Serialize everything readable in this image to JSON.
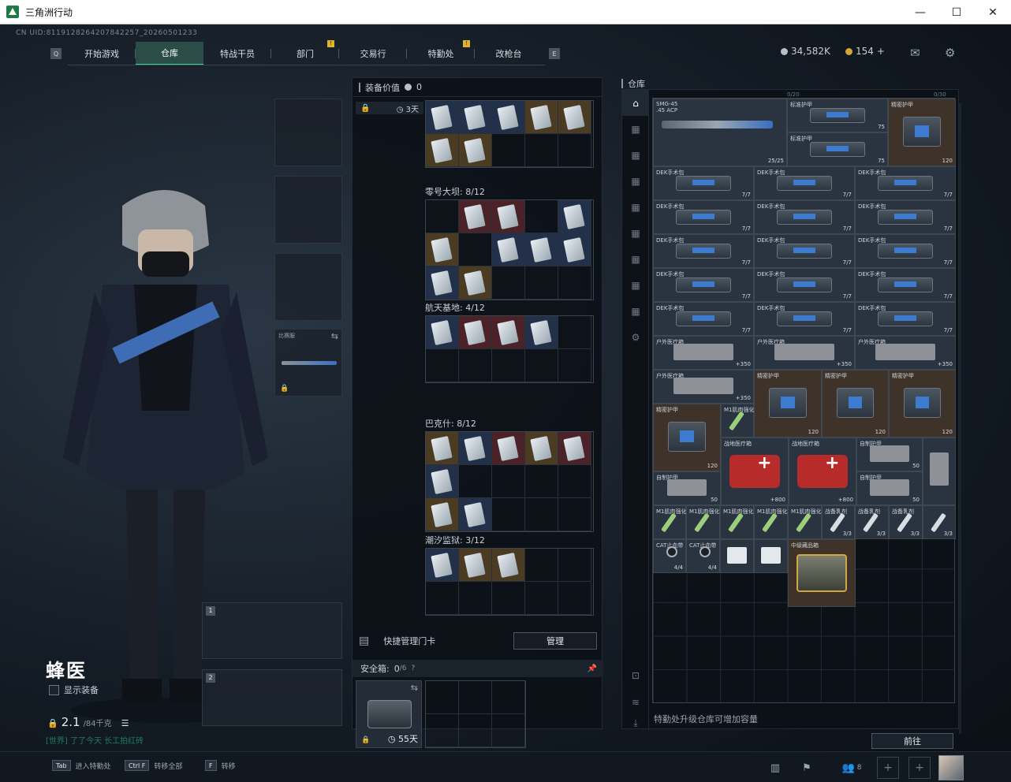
{
  "window": {
    "title": "三角洲行动",
    "controls": [
      "—",
      "☐",
      "✕"
    ]
  },
  "uid": "CN UID:8119128264207842257_20260501233",
  "nav": {
    "tabs": [
      {
        "label": "开始游戏",
        "active": false,
        "alert": false
      },
      {
        "label": "仓库",
        "active": true,
        "alert": false
      },
      {
        "label": "特战干员",
        "active": false,
        "alert": false
      },
      {
        "label": "部门",
        "active": false,
        "alert": true
      },
      {
        "label": "交易行",
        "active": false,
        "alert": false
      },
      {
        "label": "特勤处",
        "active": false,
        "alert": true
      },
      {
        "label": "改枪台",
        "active": false,
        "alert": false
      }
    ],
    "left_key": "Q",
    "right_key": "E",
    "alert_mark": "!"
  },
  "currency": {
    "hafcoin": "34,582K",
    "tickets": "154",
    "plus": "+"
  },
  "character": {
    "name": "蜂医",
    "show_equipment": "显示装备",
    "weight": "2.1",
    "weight_max": "/84千克",
    "tags": "[世界] 了了今天 长工拍红砖"
  },
  "slots": {
    "secure_weapon_label": "比赛服",
    "weapon_1": "1",
    "weapon_2": "2"
  },
  "keychain": {
    "header": "装备价值",
    "value": "0",
    "timer": "3天",
    "groups": [
      {
        "title": "零号大坝: 8/12"
      },
      {
        "title": "航天基地: 4/12"
      },
      {
        "title": "巴克什: 8/12"
      },
      {
        "title": "潮汐监狱: 3/12"
      }
    ],
    "quick_manage": "快捷管理门卡",
    "manage_button": "管理"
  },
  "safebox": {
    "title": "安全箱:",
    "count": "0",
    "capacity": "/6",
    "help": "?",
    "timer": "55天"
  },
  "warehouse": {
    "title": "仓库",
    "foot_text": "特勤处升级仓库可增加容量",
    "go_button": "前往",
    "counter_left": "0/20",
    "counter_right": "0/30",
    "items": [
      {
        "name": "SMG-45",
        "sub": ".45 ACP",
        "qty": "25/25"
      },
      {
        "name": "精密护甲",
        "qty": "120"
      },
      {
        "name": "DEK手术包",
        "qty": "7/7"
      },
      {
        "name": "户外医疗箱",
        "qty": "+350"
      },
      {
        "name": "M1肌肉强化",
        "qty": ""
      },
      {
        "name": "战地医疗箱",
        "qty": "+800"
      },
      {
        "name": "自制护甲",
        "qty": "50"
      },
      {
        "name": "CAT止血带",
        "qty": "4/4"
      },
      {
        "name": "中级藏品箱",
        "qty": ""
      },
      {
        "name": "战备乳剂",
        "qty": "3/3"
      },
      {
        "name": "标准护甲",
        "qty": "75"
      }
    ]
  },
  "bottom": {
    "hints": [
      {
        "key": "Tab",
        "label": "进入特勤处"
      },
      {
        "key": "Ctrl F",
        "label": "转移全部"
      },
      {
        "key": "F",
        "label": "转移"
      }
    ],
    "friends": "8"
  },
  "colors": {
    "accent": "#3fd19b",
    "alert": "#e0b12a",
    "tag": "#1f7a66"
  }
}
